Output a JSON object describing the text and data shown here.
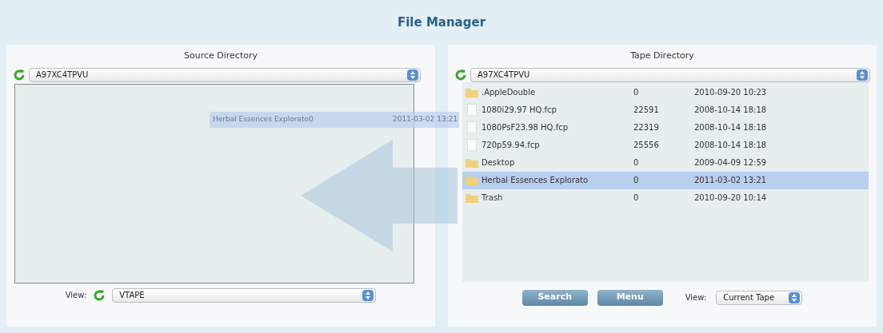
{
  "title": "File Manager",
  "source": {
    "title": "Source Directory",
    "directory": "A97XC4TPVU",
    "view_label": "View:",
    "view_value": "VTAPE"
  },
  "drag_ghost": {
    "name": "Herbal Essences Explorato0",
    "modified": "2011-03-02 13:21"
  },
  "tape": {
    "title": "Tape Directory",
    "directory": "A97XC4TPVU",
    "rows": [
      {
        "kind": "folder",
        "name": ".AppleDouble",
        "size": "0",
        "modified": "2010-09-20 10:23",
        "selected": false
      },
      {
        "kind": "file",
        "name": "1080i29.97 HQ.fcp",
        "size": "22591",
        "modified": "2008-10-14 18:18",
        "selected": false
      },
      {
        "kind": "file",
        "name": "1080PsF23.98 HQ.fcp",
        "size": "22319",
        "modified": "2008-10-14 18:18",
        "selected": false
      },
      {
        "kind": "file",
        "name": "720p59.94.fcp",
        "size": "25556",
        "modified": "2008-10-14 18:18",
        "selected": false
      },
      {
        "kind": "folder",
        "name": "Desktop",
        "size": "0",
        "modified": "2009-04-09 12:59",
        "selected": false
      },
      {
        "kind": "folder",
        "name": "Herbal Essences Explorato",
        "size": "0",
        "modified": "2011-03-02 13:21",
        "selected": true
      },
      {
        "kind": "folder",
        "name": "Trash",
        "size": "0",
        "modified": "2010-09-20 10:14",
        "selected": false
      }
    ],
    "buttons": [
      "Search",
      "Menu"
    ],
    "view_label": "View:",
    "view_value": "Current Tape"
  }
}
